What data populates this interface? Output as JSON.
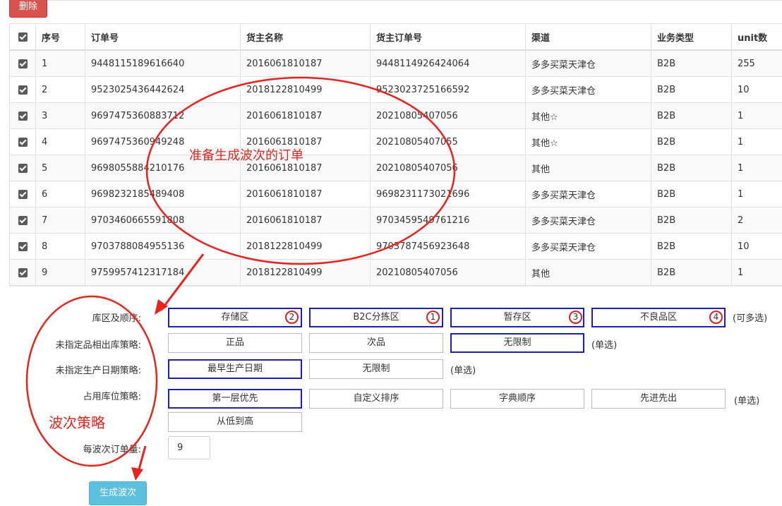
{
  "toolbar": {
    "delete_label": "删除"
  },
  "table": {
    "headers": [
      "序号",
      "订单号",
      "货主名称",
      "货主订单号",
      "渠道",
      "业务类型",
      "unit数"
    ],
    "rows": [
      [
        "1",
        "9448115189616640",
        "2016061810187",
        "9448114926424064",
        "多多买菜天津仓",
        "B2B",
        "255"
      ],
      [
        "2",
        "9523025436442624",
        "2018122810499",
        "9523023725166592",
        "多多买菜天津仓",
        "B2B",
        "10"
      ],
      [
        "3",
        "9697475360883712",
        "2016061810187",
        "20210805407056",
        "其他☆",
        "B2B",
        "1"
      ],
      [
        "4",
        "9697475360949248",
        "2016061810187",
        "20210805407055",
        "其他☆",
        "B2B",
        "1"
      ],
      [
        "5",
        "9698055884210176",
        "2016061810187",
        "20210805407056",
        "其他",
        "B2B",
        "1"
      ],
      [
        "6",
        "9698232185489408",
        "2016061810187",
        "9698231173021696",
        "多多买菜天津仓",
        "B2B",
        "1"
      ],
      [
        "7",
        "9703460665591808",
        "2016061810187",
        "9703459549761216",
        "多多买菜天津仓",
        "B2B",
        "2"
      ],
      [
        "8",
        "9703788084955136",
        "2018122810499",
        "9703787456923648",
        "多多买菜天津仓",
        "B2B",
        "10"
      ],
      [
        "9",
        "9759957412317184",
        "2018122810499",
        "20210805407056",
        "其他",
        "B2B",
        "1"
      ]
    ]
  },
  "form": {
    "zone_order": {
      "label": "库区及顺序:",
      "options": [
        "存储区",
        "B2C分拣区",
        "暂存区",
        "不良品区"
      ],
      "badges": [
        "2",
        "1",
        "3",
        "4"
      ],
      "hint": "(可多选)"
    },
    "unspecified_out": {
      "label": "未指定品相出库策略:",
      "options": [
        "正品",
        "次品",
        "无限制"
      ],
      "hint": "(单选)"
    },
    "unspecified_date": {
      "label": "未指定生产日期策略:",
      "options": [
        "最早生产日期",
        "无限制"
      ],
      "hint": "(单选)"
    },
    "location_strategy": {
      "label": "占用库位策略:",
      "options": [
        "第一层优先",
        "自定义排序",
        "字典顺序",
        "先进先出",
        "从低到高"
      ],
      "hint": "(单选)"
    },
    "orders_per_wave": {
      "label": "每波次订单量:",
      "value": "9"
    },
    "generate_label": "生成波次"
  },
  "annotations": {
    "orders_note": "准备生成波次的订单",
    "strategy_note": "波次策略",
    "accent": "#e8221c"
  }
}
